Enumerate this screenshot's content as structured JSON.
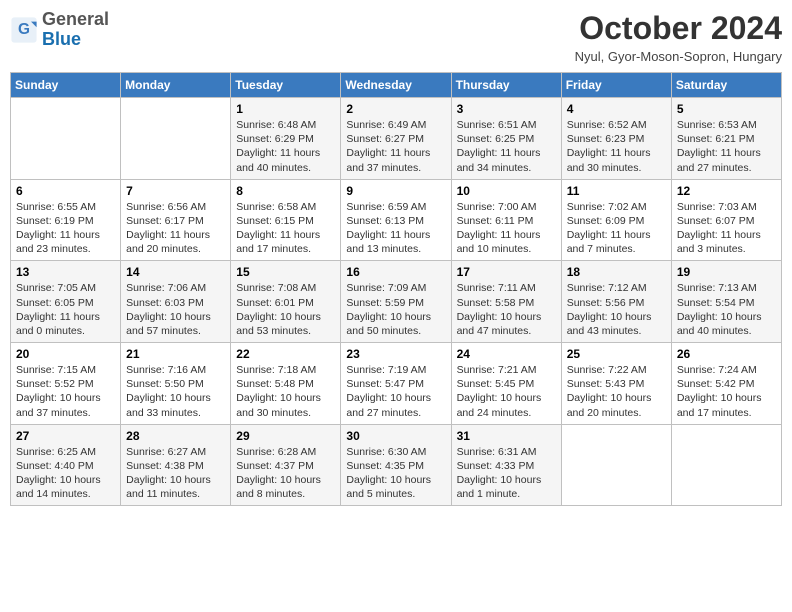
{
  "logo": {
    "general": "General",
    "blue": "Blue"
  },
  "title": "October 2024",
  "location": "Nyul, Gyor-Moson-Sopron, Hungary",
  "headers": [
    "Sunday",
    "Monday",
    "Tuesday",
    "Wednesday",
    "Thursday",
    "Friday",
    "Saturday"
  ],
  "weeks": [
    [
      {
        "day": "",
        "data": ""
      },
      {
        "day": "",
        "data": ""
      },
      {
        "day": "1",
        "data": "Sunrise: 6:48 AM\nSunset: 6:29 PM\nDaylight: 11 hours and 40 minutes."
      },
      {
        "day": "2",
        "data": "Sunrise: 6:49 AM\nSunset: 6:27 PM\nDaylight: 11 hours and 37 minutes."
      },
      {
        "day": "3",
        "data": "Sunrise: 6:51 AM\nSunset: 6:25 PM\nDaylight: 11 hours and 34 minutes."
      },
      {
        "day": "4",
        "data": "Sunrise: 6:52 AM\nSunset: 6:23 PM\nDaylight: 11 hours and 30 minutes."
      },
      {
        "day": "5",
        "data": "Sunrise: 6:53 AM\nSunset: 6:21 PM\nDaylight: 11 hours and 27 minutes."
      }
    ],
    [
      {
        "day": "6",
        "data": "Sunrise: 6:55 AM\nSunset: 6:19 PM\nDaylight: 11 hours and 23 minutes."
      },
      {
        "day": "7",
        "data": "Sunrise: 6:56 AM\nSunset: 6:17 PM\nDaylight: 11 hours and 20 minutes."
      },
      {
        "day": "8",
        "data": "Sunrise: 6:58 AM\nSunset: 6:15 PM\nDaylight: 11 hours and 17 minutes."
      },
      {
        "day": "9",
        "data": "Sunrise: 6:59 AM\nSunset: 6:13 PM\nDaylight: 11 hours and 13 minutes."
      },
      {
        "day": "10",
        "data": "Sunrise: 7:00 AM\nSunset: 6:11 PM\nDaylight: 11 hours and 10 minutes."
      },
      {
        "day": "11",
        "data": "Sunrise: 7:02 AM\nSunset: 6:09 PM\nDaylight: 11 hours and 7 minutes."
      },
      {
        "day": "12",
        "data": "Sunrise: 7:03 AM\nSunset: 6:07 PM\nDaylight: 11 hours and 3 minutes."
      }
    ],
    [
      {
        "day": "13",
        "data": "Sunrise: 7:05 AM\nSunset: 6:05 PM\nDaylight: 11 hours and 0 minutes."
      },
      {
        "day": "14",
        "data": "Sunrise: 7:06 AM\nSunset: 6:03 PM\nDaylight: 10 hours and 57 minutes."
      },
      {
        "day": "15",
        "data": "Sunrise: 7:08 AM\nSunset: 6:01 PM\nDaylight: 10 hours and 53 minutes."
      },
      {
        "day": "16",
        "data": "Sunrise: 7:09 AM\nSunset: 5:59 PM\nDaylight: 10 hours and 50 minutes."
      },
      {
        "day": "17",
        "data": "Sunrise: 7:11 AM\nSunset: 5:58 PM\nDaylight: 10 hours and 47 minutes."
      },
      {
        "day": "18",
        "data": "Sunrise: 7:12 AM\nSunset: 5:56 PM\nDaylight: 10 hours and 43 minutes."
      },
      {
        "day": "19",
        "data": "Sunrise: 7:13 AM\nSunset: 5:54 PM\nDaylight: 10 hours and 40 minutes."
      }
    ],
    [
      {
        "day": "20",
        "data": "Sunrise: 7:15 AM\nSunset: 5:52 PM\nDaylight: 10 hours and 37 minutes."
      },
      {
        "day": "21",
        "data": "Sunrise: 7:16 AM\nSunset: 5:50 PM\nDaylight: 10 hours and 33 minutes."
      },
      {
        "day": "22",
        "data": "Sunrise: 7:18 AM\nSunset: 5:48 PM\nDaylight: 10 hours and 30 minutes."
      },
      {
        "day": "23",
        "data": "Sunrise: 7:19 AM\nSunset: 5:47 PM\nDaylight: 10 hours and 27 minutes."
      },
      {
        "day": "24",
        "data": "Sunrise: 7:21 AM\nSunset: 5:45 PM\nDaylight: 10 hours and 24 minutes."
      },
      {
        "day": "25",
        "data": "Sunrise: 7:22 AM\nSunset: 5:43 PM\nDaylight: 10 hours and 20 minutes."
      },
      {
        "day": "26",
        "data": "Sunrise: 7:24 AM\nSunset: 5:42 PM\nDaylight: 10 hours and 17 minutes."
      }
    ],
    [
      {
        "day": "27",
        "data": "Sunrise: 6:25 AM\nSunset: 4:40 PM\nDaylight: 10 hours and 14 minutes."
      },
      {
        "day": "28",
        "data": "Sunrise: 6:27 AM\nSunset: 4:38 PM\nDaylight: 10 hours and 11 minutes."
      },
      {
        "day": "29",
        "data": "Sunrise: 6:28 AM\nSunset: 4:37 PM\nDaylight: 10 hours and 8 minutes."
      },
      {
        "day": "30",
        "data": "Sunrise: 6:30 AM\nSunset: 4:35 PM\nDaylight: 10 hours and 5 minutes."
      },
      {
        "day": "31",
        "data": "Sunrise: 6:31 AM\nSunset: 4:33 PM\nDaylight: 10 hours and 1 minute."
      },
      {
        "day": "",
        "data": ""
      },
      {
        "day": "",
        "data": ""
      }
    ]
  ]
}
